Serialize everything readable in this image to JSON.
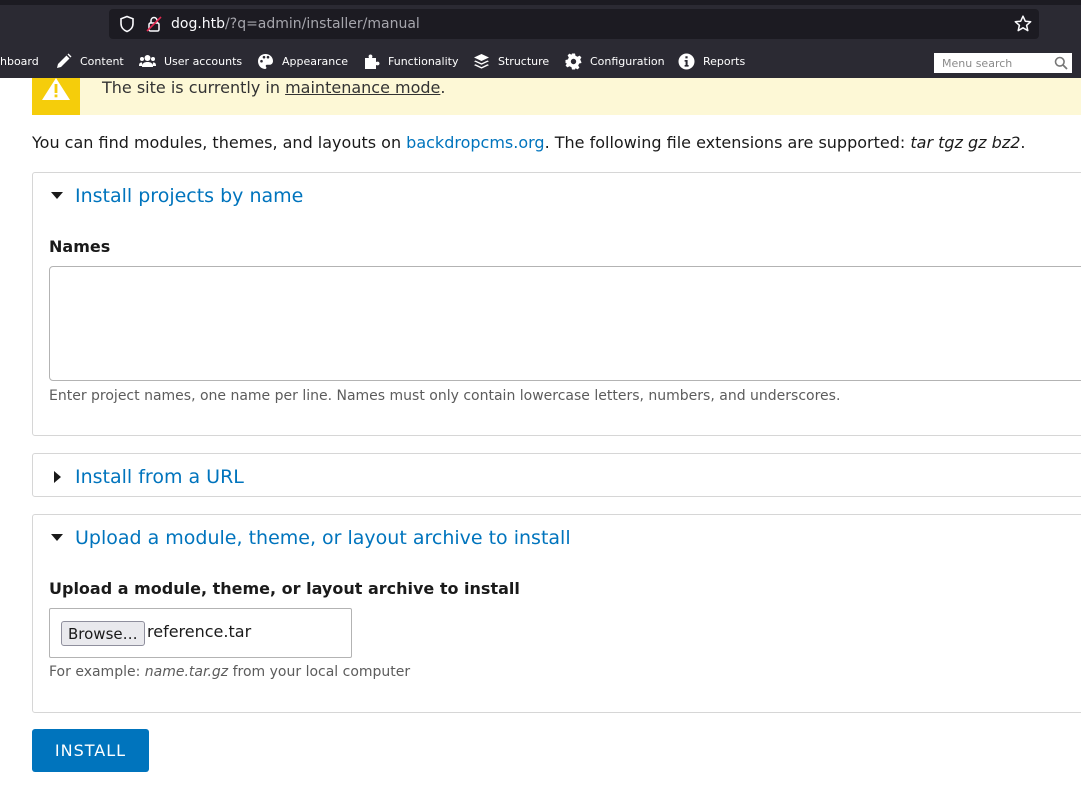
{
  "browser": {
    "url_host": "dog.htb",
    "url_path": "/?q=admin/installer/manual"
  },
  "admin_menu": {
    "items": [
      {
        "label": "hboard",
        "icon": "dashboard-icon"
      },
      {
        "label": "Content",
        "icon": "pencil-icon"
      },
      {
        "label": "User accounts",
        "icon": "users-icon"
      },
      {
        "label": "Appearance",
        "icon": "palette-icon"
      },
      {
        "label": "Functionality",
        "icon": "puzzle-icon"
      },
      {
        "label": "Structure",
        "icon": "layers-icon"
      },
      {
        "label": "Configuration",
        "icon": "gear-icon"
      },
      {
        "label": "Reports",
        "icon": "info-icon"
      }
    ],
    "search_placeholder": "Menu search"
  },
  "maintenance": {
    "text_before": "The site is currently in ",
    "link": "maintenance mode",
    "text_after": "."
  },
  "intro": {
    "text_before": "You can find modules, themes, and layouts on ",
    "link": "backdropcms.org",
    "text_middle": ". The following file extensions are supported: ",
    "extensions": "tar tgz gz bz2",
    "text_after": "."
  },
  "fieldsets": {
    "by_name": {
      "legend": "Install projects by name",
      "label": "Names",
      "value": "",
      "description": "Enter project names, one name per line. Names must only contain lowercase letters, numbers, and underscores."
    },
    "from_url": {
      "legend": "Install from a URL"
    },
    "upload": {
      "legend": "Upload a module, theme, or layout archive to install",
      "label": "Upload a module, theme, or layout archive to install",
      "browse_label": "Browse…",
      "file_name": "reference.tar",
      "desc_before": "For example: ",
      "desc_example": "name.tar.gz",
      "desc_after": " from your local computer"
    }
  },
  "install_button": "INSTALL",
  "colors": {
    "link": "#0074bd",
    "toolbar_bg": "#2b2a33",
    "warning": "#f5cd0b",
    "warning_bg": "#fdf8d6"
  }
}
